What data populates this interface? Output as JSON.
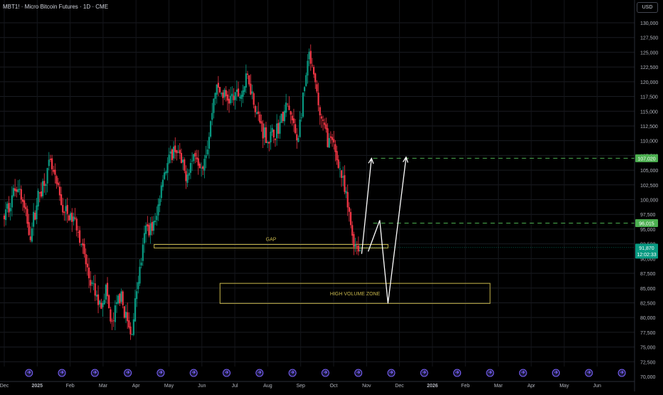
{
  "header": {
    "title": "MBT1! · Micro Bitcoin Futures · 1D · CME",
    "currency": "USD"
  },
  "chart_data": {
    "type": "candlestick",
    "ylim": [
      70000,
      130000
    ],
    "y_ticks": [
      130000,
      127500,
      125000,
      122500,
      120000,
      117500,
      115000,
      112500,
      110000,
      107500,
      105000,
      102500,
      100000,
      97500,
      95000,
      92500,
      90000,
      87500,
      85000,
      82500,
      80000,
      77500,
      75000,
      72500,
      70000
    ],
    "y_tick_labels": [
      "130,000",
      "127,500",
      "125,000",
      "122,500",
      "120,000",
      "117,500",
      "115,000",
      "112,500",
      "110,000",
      "107,500",
      "105,000",
      "102,500",
      "100,000",
      "97,500",
      "95,000",
      "92,500",
      "90,000",
      "87,500",
      "85,000",
      "82,500",
      "80,000",
      "77,500",
      "75,000",
      "72,500",
      "70,000"
    ],
    "x_ticks": [
      {
        "label": "Dec",
        "bold": false
      },
      {
        "label": "2025",
        "bold": true
      },
      {
        "label": "Feb",
        "bold": false
      },
      {
        "label": "Mar",
        "bold": false
      },
      {
        "label": "Apr",
        "bold": false
      },
      {
        "label": "May",
        "bold": false
      },
      {
        "label": "Jun",
        "bold": false
      },
      {
        "label": "Jul",
        "bold": false
      },
      {
        "label": "Aug",
        "bold": false
      },
      {
        "label": "Sep",
        "bold": false
      },
      {
        "label": "Oct",
        "bold": false
      },
      {
        "label": "Nov",
        "bold": false
      },
      {
        "label": "Dec",
        "bold": false
      },
      {
        "label": "2026",
        "bold": true
      },
      {
        "label": "Feb",
        "bold": false
      },
      {
        "label": "Mar",
        "bold": false
      },
      {
        "label": "Apr",
        "bold": false
      },
      {
        "label": "May",
        "bold": false
      },
      {
        "label": "Jun",
        "bold": false
      }
    ],
    "anchors": [
      {
        "m": 0,
        "p": 97000
      },
      {
        "m": 0.4,
        "p": 103000
      },
      {
        "m": 0.8,
        "p": 94000
      },
      {
        "m": 1.0,
        "p": 100000
      },
      {
        "m": 1.4,
        "p": 106000
      },
      {
        "m": 1.8,
        "p": 98000
      },
      {
        "m": 2.2,
        "p": 96000
      },
      {
        "m": 2.6,
        "p": 86000
      },
      {
        "m": 2.9,
        "p": 82000
      },
      {
        "m": 3.1,
        "p": 85000
      },
      {
        "m": 3.25,
        "p": 78000
      },
      {
        "m": 3.5,
        "p": 84000
      },
      {
        "m": 3.7,
        "p": 80000
      },
      {
        "m": 3.85,
        "p": 76500
      },
      {
        "m": 4.0,
        "p": 84000
      },
      {
        "m": 4.3,
        "p": 95000
      },
      {
        "m": 4.6,
        "p": 96000
      },
      {
        "m": 4.8,
        "p": 104000
      },
      {
        "m": 5.2,
        "p": 109000
      },
      {
        "m": 5.5,
        "p": 104000
      },
      {
        "m": 5.8,
        "p": 108000
      },
      {
        "m": 6.0,
        "p": 106000
      },
      {
        "m": 6.2,
        "p": 110000
      },
      {
        "m": 6.4,
        "p": 119000
      },
      {
        "m": 6.8,
        "p": 117000
      },
      {
        "m": 7.2,
        "p": 118000
      },
      {
        "m": 7.4,
        "p": 121000
      },
      {
        "m": 7.7,
        "p": 114000
      },
      {
        "m": 8.0,
        "p": 110000
      },
      {
        "m": 8.3,
        "p": 112000
      },
      {
        "m": 8.6,
        "p": 116000
      },
      {
        "m": 8.9,
        "p": 110000
      },
      {
        "m": 9.1,
        "p": 118000
      },
      {
        "m": 9.25,
        "p": 124500
      },
      {
        "m": 9.45,
        "p": 119000
      },
      {
        "m": 9.6,
        "p": 114000
      },
      {
        "m": 9.85,
        "p": 110000
      },
      {
        "m": 10.0,
        "p": 109000
      },
      {
        "m": 10.2,
        "p": 105000
      },
      {
        "m": 10.45,
        "p": 98000
      },
      {
        "m": 10.6,
        "p": 93000
      },
      {
        "m": 10.8,
        "p": 91500
      }
    ],
    "annotations": {
      "gap_label": "GAP",
      "gap_zone": [
        91800,
        92400
      ],
      "hvz_label": "HIGH VOLUME ZONE",
      "hvz_zone": [
        82400,
        85800
      ],
      "target_levels": [
        {
          "value": 107020,
          "label": "107,020",
          "color": "#4caf50"
        },
        {
          "value": 96015,
          "label": "96,015",
          "color": "#4caf50"
        }
      ],
      "last_price": {
        "value": 91870,
        "label": "91,870",
        "countdown": "12:02:33",
        "color": "#089981"
      },
      "arrow_a": [
        {
          "m": 10.85,
          "p": 90800
        },
        {
          "m": 11.15,
          "p": 107000
        }
      ],
      "arrow_b": [
        {
          "m": 11.05,
          "p": 91200
        },
        {
          "m": 11.4,
          "p": 96500
        },
        {
          "m": 11.65,
          "p": 82400
        },
        {
          "m": 12.2,
          "p": 107200
        }
      ]
    },
    "colors": {
      "up": "#089981",
      "down": "#f23645",
      "zone": "#c9b84c",
      "arrow": "#ffffff",
      "events": "#7b61ff"
    },
    "grid": true,
    "events_count": 19
  }
}
